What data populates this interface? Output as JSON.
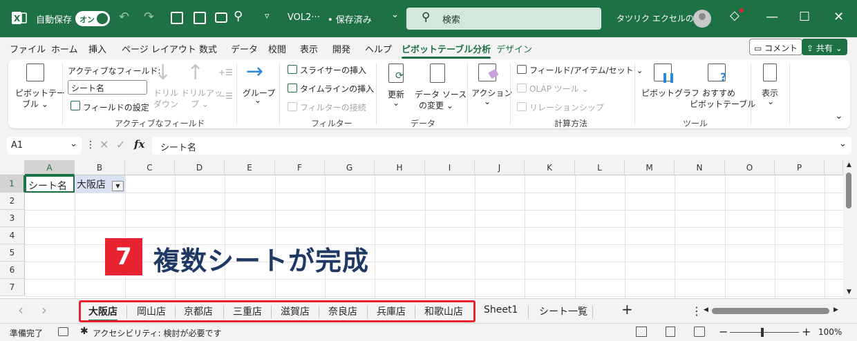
{
  "titlebar": {
    "autosave_label": "自動保存",
    "autosave_state": "オン",
    "filename": "VOL2···",
    "save_status": "• 保存済み",
    "save_status_caret": "⌄",
    "search_placeholder": "検索",
    "user_name": "タツリク エクセルの森",
    "window_controls": [
      "—",
      "☐",
      "✕"
    ]
  },
  "menu": {
    "tabs": [
      "ファイル",
      "ホーム",
      "挿入",
      "ページ レイアウト",
      "数式",
      "データ",
      "校閲",
      "表示",
      "開発",
      "ヘルプ",
      "ピボットテーブル分析",
      "デザイン"
    ],
    "active_index": 10,
    "comment_button": "コメント",
    "share_button": "共有"
  },
  "ribbon": {
    "pivot_table_label_1": "ピボットテー",
    "pivot_table_label_2": "ブル ⌄",
    "active_field_header": "アクティブなフィールド:",
    "active_field_value": "シート名",
    "field_settings": "フィールドの設定",
    "drill_down_1": "ドリル",
    "drill_down_2": "ダウン",
    "drill_up_1": "ドリルアッ",
    "drill_up_2": "プ ⌄",
    "group_active_field": "アクティブなフィールド",
    "group_button": "グループ",
    "slicer": "スライサーの挿入",
    "timeline": "タイムラインの挿入",
    "filter_connect": "フィルターの接続",
    "group_filter": "フィルター",
    "refresh": "更新",
    "change_source_1": "データ ソース",
    "change_source_2": "の変更 ⌄",
    "group_data": "データ",
    "action": "アクション",
    "fields_items_sets": "フィールド/アイテム/セット ⌄",
    "olap_tools": "OLAP ツール ⌄",
    "relationships": "リレーションシップ",
    "group_calc": "計算方法",
    "pivot_chart": "ピボットグラフ",
    "recommended_1": "おすすめ",
    "recommended_2": "ピボットテーブル",
    "group_tools": "ツール",
    "show": "表示"
  },
  "formula_bar": {
    "name_box": "A1",
    "fx_label": "fx",
    "formula": "シート名"
  },
  "grid": {
    "columns": [
      "A",
      "B",
      "C",
      "D",
      "E",
      "F",
      "G",
      "H",
      "I",
      "J",
      "K",
      "L",
      "M",
      "N",
      "O",
      "P"
    ],
    "rows": [
      "1",
      "2",
      "3",
      "4",
      "5",
      "6",
      "7"
    ],
    "a1": "シート名",
    "b1": "大阪店"
  },
  "annotation": {
    "number": "7",
    "text": "複数シートが完成"
  },
  "sheet_tabs": {
    "nav_prev": "‹",
    "nav_next": "›",
    "tabs": [
      "大阪店",
      "岡山店",
      "京都店",
      "三重店",
      "滋賀店",
      "奈良店",
      "兵庫店",
      "和歌山店",
      "Sheet1",
      "シート一覧"
    ],
    "add": "+",
    "more": "⋮"
  },
  "status_bar": {
    "ready": "準備完了",
    "accessibility": "アクセシビリティ: 検討が必要です",
    "zoom": "100%",
    "zoom_minus": "−",
    "zoom_plus": "+"
  },
  "colors": {
    "brand": "#1e7145",
    "highlight": "#e8232f",
    "annotation_text": "#1f3864"
  }
}
